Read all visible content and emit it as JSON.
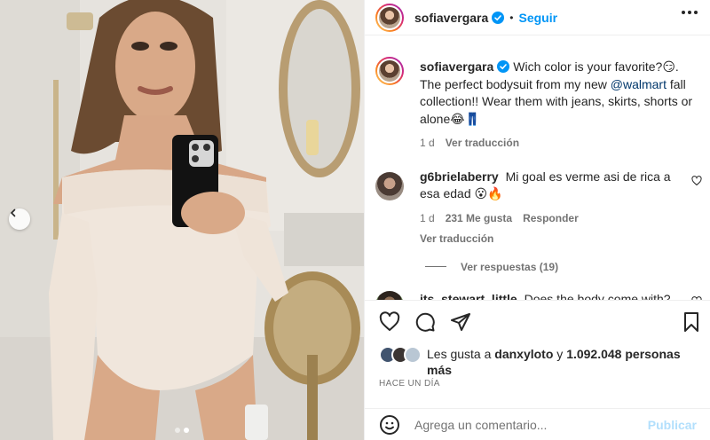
{
  "post": {
    "username": "sofiavergara",
    "separator": "•",
    "follow_label": "Seguir",
    "caption": {
      "username": "sofiavergara",
      "text": "Wich color is your favorite?😏. The perfect bodysuit from my new ",
      "mention": "@walmart",
      "text_after": " fall collection!! Wear them with jeans, skirts, shorts or alone😂👖",
      "age": "1 d",
      "translate_label": "Ver traducción"
    },
    "comments": [
      {
        "username": "g6brielaberry",
        "text": "Mi goal es verme asi de rica a esa edad 😮🔥",
        "age": "1 d",
        "likes": "231 Me gusta",
        "reply_label": "Responder",
        "translate_label": "Ver traducción",
        "replies_label": "Ver respuestas (19)"
      },
      {
        "username": "its_stewart_little",
        "text": "Does the body come with?"
      }
    ],
    "likes": {
      "prefix": "Les gusta a ",
      "user": "danxyloto",
      "middle": " y ",
      "count": "1.092.048 personas más"
    },
    "timestamp": "HACE UN DÍA",
    "add_comment_placeholder": "Agrega un comentario...",
    "publish_label": "Publicar"
  },
  "colors": {
    "accent": "#0095f6",
    "publish_disabled": "#b2dffc",
    "muted": "#737373",
    "text": "#262626"
  },
  "carousel": {
    "current": 2,
    "total": 2
  }
}
